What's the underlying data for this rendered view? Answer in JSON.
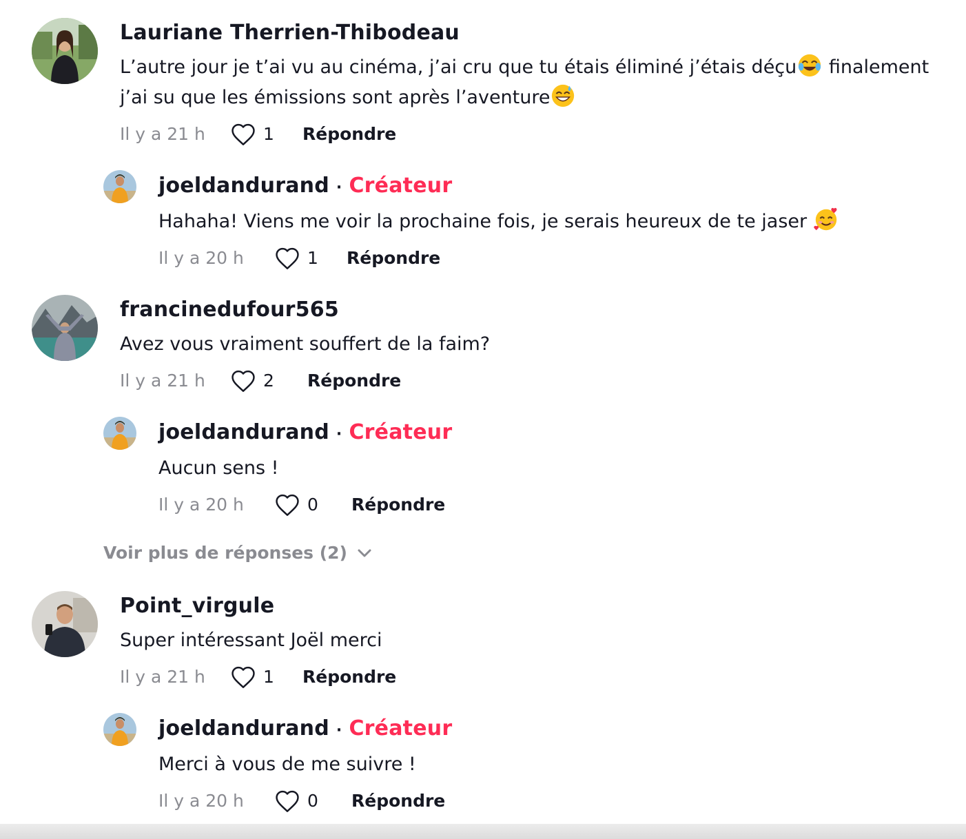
{
  "comments": [
    {
      "username": "Lauriane Therrien-Thibodeau",
      "text_part1": "L’autre jour je t’ai vu au cinéma, j’ai cru que tu étais éliminé j’étais déçu",
      "text_part2": " finalement j’ai su que les émissions sont après l’aventure",
      "time": "Il y a 21 h",
      "likes": "1",
      "reply_label": "Répondre",
      "emoji_1": "face-with-tears-of-joy-icon",
      "emoji_2": "grinning-face-with-sweat-icon",
      "reply": {
        "username": "joeldandurand",
        "separator": "·",
        "badge": "Créateur",
        "text": "Hahaha! Viens me voir la prochaine fois, je serais heureux de te jaser ",
        "emoji": "smiling-face-with-hearts-icon",
        "time": "Il y a 20 h",
        "likes": "1",
        "reply_label": "Répondre"
      }
    },
    {
      "username": "francinedufour565",
      "text": "Avez vous vraiment souffert de la faim?",
      "time": "Il y a 21 h",
      "likes": "2",
      "reply_label": "Répondre",
      "reply": {
        "username": "joeldandurand",
        "separator": "·",
        "badge": "Créateur",
        "text": "Aucun sens !",
        "time": "Il y a 20 h",
        "likes": "0",
        "reply_label": "Répondre"
      },
      "more_replies": "Voir plus de réponses (2)"
    },
    {
      "username": "Point_virgule",
      "text": "Super intéressant Joël merci",
      "time": "Il y a 21 h",
      "likes": "1",
      "reply_label": "Répondre",
      "reply": {
        "username": "joeldandurand",
        "separator": "·",
        "badge": "Créateur",
        "text": "Merci à vous de me suivre !",
        "time": "Il y a 20 h",
        "likes": "0",
        "reply_label": "Répondre"
      }
    }
  ],
  "colors": {
    "creator_badge": "#fe2c55",
    "muted": "#8a8b91",
    "text": "#161823"
  }
}
